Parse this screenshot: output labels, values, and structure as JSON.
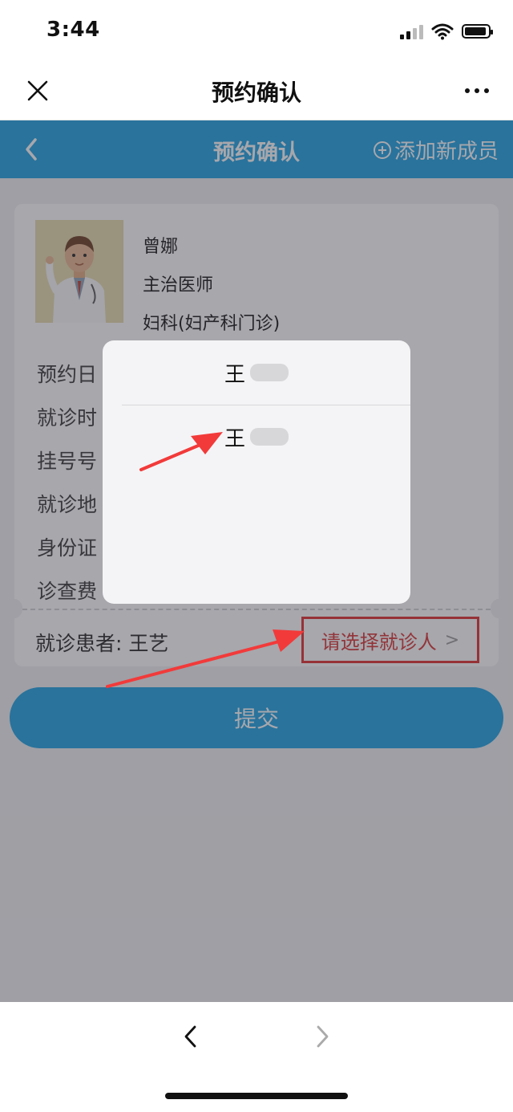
{
  "status": {
    "time": "3:44",
    "signal_icon": "signal-icon",
    "wifi_icon": "wifi-icon",
    "battery_icon": "battery-icon",
    "battery_level": 0.85
  },
  "wechat_bar": {
    "title": "预约确认",
    "close_icon": "close-icon",
    "more_icon": "more-icon"
  },
  "app_bar": {
    "back_icon": "chevron-left-icon",
    "title": "预约确认",
    "add_label": "添加新成员",
    "add_icon": "plus-circle-icon",
    "color": "#1aa0e2"
  },
  "doctor": {
    "name": "曾娜",
    "title": "主治医师",
    "department": "妇科(妇产科门诊)"
  },
  "details": {
    "labels": [
      "预约日",
      "就诊时",
      "挂号号",
      "就诊地",
      "身份证",
      "诊查费"
    ]
  },
  "patient": {
    "label": "就诊患者:",
    "name": "王艺"
  },
  "choose_patient": {
    "label": "请选择就诊人",
    "chevron": ">",
    "highlight_color": "#e02a2a"
  },
  "submit": {
    "label": "提交"
  },
  "dialog": {
    "options": [
      {
        "visible_text": "王"
      },
      {
        "visible_text": "王"
      }
    ]
  },
  "bottom_nav": {
    "back_icon": "chevron-left-icon",
    "forward_icon": "chevron-right-icon"
  }
}
